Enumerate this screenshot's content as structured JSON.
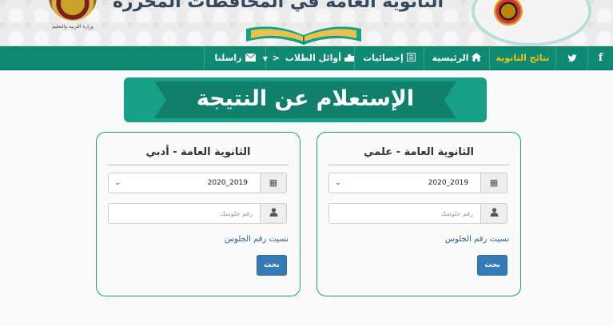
{
  "header": {
    "title": "الثانوية العامة في المحافظات المحررة",
    "ministry_caption": "وزارة التربية والتعليم"
  },
  "nav": {
    "items": [
      {
        "label": "f",
        "icon": "facebook-icon"
      },
      {
        "label": "t",
        "icon": "twitter-icon"
      },
      {
        "label": "نتائج الثانوية",
        "active": true
      },
      {
        "label": "الرئيسية",
        "icon": "home-icon"
      },
      {
        "label": "إحصائيات",
        "icon": "stats-icon"
      },
      {
        "label": "أوائل الطلاب",
        "icon": "podium-icon",
        "dropdown": true
      },
      {
        "label": "راسلنا",
        "icon": "envelope-icon"
      }
    ]
  },
  "banner": {
    "heading": "الإستعلام عن النتيجة"
  },
  "cards": {
    "scientific": {
      "title": "الثانوية العامة - علمي",
      "year_value": "2020_2019",
      "seat_placeholder": "رقم جلوسك",
      "forgot_label": "نسيت رقم الجلوس",
      "search_label": "بحث"
    },
    "literary": {
      "title": "الثانوية العامة - أدبي",
      "year_value": "2020_2019",
      "seat_placeholder": "رقم جلوسك",
      "forgot_label": "نسيت رقم الجلوس",
      "search_label": "بحث"
    }
  },
  "colors": {
    "primary_green": "#0f8a72",
    "ribbon_green": "#16a085",
    "active_nav": "#f1c40f",
    "button_blue": "#337ab7",
    "link_blue": "#2a6496"
  }
}
